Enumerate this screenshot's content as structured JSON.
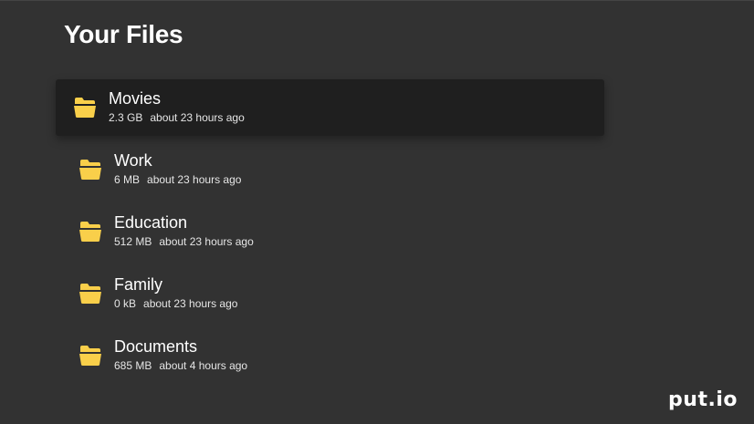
{
  "header": {
    "title": "Your Files"
  },
  "files": [
    {
      "name": "Movies",
      "size": "2.3 GB",
      "modified": "about 23 hours ago",
      "icon": "folder-icon",
      "focused": true
    },
    {
      "name": "Work",
      "size": "6 MB",
      "modified": "about 23 hours ago",
      "icon": "folder-icon",
      "focused": false
    },
    {
      "name": "Education",
      "size": "512 MB",
      "modified": "about 23 hours ago",
      "icon": "folder-icon",
      "focused": false
    },
    {
      "name": "Family",
      "size": "0 kB",
      "modified": "about 23 hours ago",
      "icon": "folder-icon",
      "focused": false
    },
    {
      "name": "Documents",
      "size": "685 MB",
      "modified": "about 4 hours ago",
      "icon": "folder-icon",
      "focused": false
    }
  ],
  "brand": {
    "logo_text": "put.io"
  },
  "colors": {
    "background": "#323232",
    "focused_row": "#1f1f1f",
    "folder": "#f9cf4a",
    "text": "#ffffff"
  }
}
